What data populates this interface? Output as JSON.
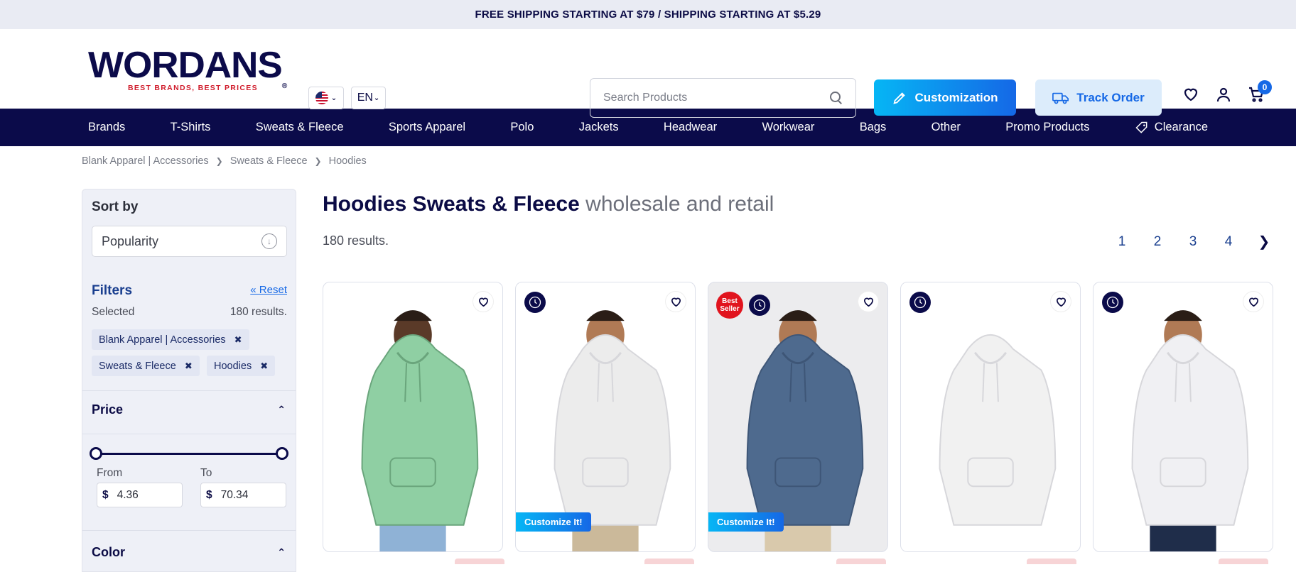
{
  "announcement": "FREE SHIPPING STARTING AT $79 / SHIPPING STARTING AT $5.29",
  "logo": {
    "name": "WORDANS",
    "tagline": "BEST BRANDS, BEST PRICES",
    "mark": "®"
  },
  "header": {
    "language": "EN",
    "search_placeholder": "Search Products",
    "customization_label": "Customization",
    "track_order_label": "Track Order",
    "cart_count": "0"
  },
  "nav": [
    "Brands",
    "T-Shirts",
    "Sweats & Fleece",
    "Sports Apparel",
    "Polo",
    "Jackets",
    "Headwear",
    "Workwear",
    "Bags",
    "Other",
    "Promo Products",
    "Clearance"
  ],
  "breadcrumb": [
    "Blank Apparel | Accessories",
    "Sweats & Fleece",
    "Hoodies"
  ],
  "sidebar": {
    "sort_title": "Sort by",
    "sort_value": "Popularity",
    "filters_title": "Filters",
    "reset_label": "« Reset",
    "selected_label": "Selected",
    "selected_count": "180 results.",
    "chips": [
      "Blank Apparel | Accessories",
      "Sweats & Fleece",
      "Hoodies"
    ],
    "price_title": "Price",
    "from_label": "From",
    "to_label": "To",
    "currency": "$",
    "price_from": "4.36",
    "price_to": "70.34",
    "color_title": "Color"
  },
  "main": {
    "title": "Hoodies Sweats & Fleece",
    "title_suffix": "wholesale and retail",
    "results": "180 results.",
    "pages": [
      "1",
      "2",
      "3",
      "4"
    ],
    "next": "❯"
  },
  "products": [
    {
      "hoodie_color": "#8fcfa3",
      "bg": "white",
      "badges": [],
      "customize": ""
    },
    {
      "hoodie_color": "#ececec",
      "bg": "white",
      "badges": [
        "clock"
      ],
      "customize": "Customize It!"
    },
    {
      "hoodie_color": "#4e6a8e",
      "bg": "grey",
      "badges": [
        "best-seller",
        "clock"
      ],
      "customize": "Customize It!",
      "best_label": "Best Seller"
    },
    {
      "hoodie_color": "#f1f1f1",
      "bg": "white",
      "badges": [
        "clock"
      ],
      "customize": ""
    },
    {
      "hoodie_color": "#f0f0f3",
      "bg": "white",
      "badges": [
        "clock"
      ],
      "customize": ""
    }
  ],
  "colors": {
    "navy": "#0b0b4a",
    "accent_blue": "#1568e6",
    "cyan": "#06b6f5",
    "red": "#e1141e"
  }
}
